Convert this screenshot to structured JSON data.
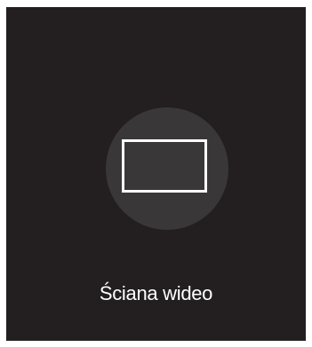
{
  "tile": {
    "label": "Ściana wideo",
    "icon": "video-wall-icon",
    "background_color": "#231f20",
    "circle_color": "#3a3738",
    "icon_color": "#ffffff"
  }
}
